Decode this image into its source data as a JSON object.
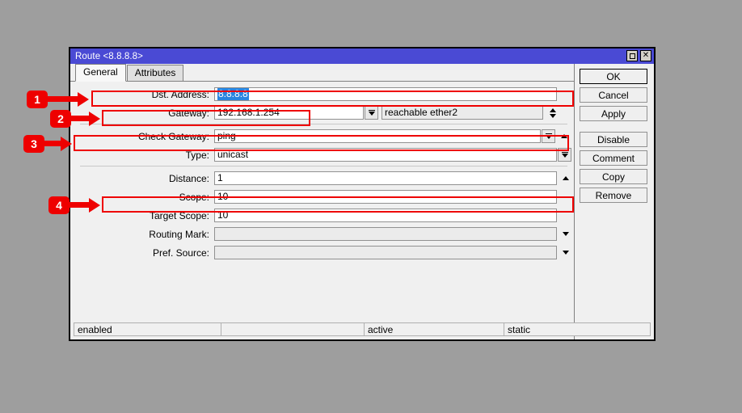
{
  "window": {
    "title": "Route <8.8.8.8>",
    "controls": {
      "maximize": "maximize-icon",
      "close": "✕"
    }
  },
  "tabs": [
    {
      "label": "General",
      "active": true
    },
    {
      "label": "Attributes",
      "active": false
    }
  ],
  "form": {
    "fields": [
      {
        "label": "Dst. Address:",
        "value": "8.8.8.8",
        "selected": true
      },
      {
        "label": "Gateway:",
        "value": "192.168.1.254",
        "secondary": "reachable ether2"
      },
      {
        "label": "Check Gateway:",
        "value": "ping"
      },
      {
        "label": "Type:",
        "value": "unicast"
      },
      {
        "label": "Distance:",
        "value": "1"
      },
      {
        "label": "Scope:",
        "value": "10"
      },
      {
        "label": "Target Scope:",
        "value": "10"
      },
      {
        "label": "Routing Mark:",
        "value": ""
      },
      {
        "label": "Pref. Source:",
        "value": ""
      }
    ]
  },
  "buttons": [
    {
      "label": "OK",
      "focused": true
    },
    {
      "label": "Cancel"
    },
    {
      "label": "Apply"
    },
    {
      "label": "Disable"
    },
    {
      "label": "Comment"
    },
    {
      "label": "Copy"
    },
    {
      "label": "Remove"
    }
  ],
  "status": [
    {
      "text": "enabled"
    },
    {
      "text": ""
    },
    {
      "text": "active"
    },
    {
      "text": "static"
    }
  ],
  "annotations": [
    {
      "number": "1",
      "target": "Dst. Address:"
    },
    {
      "number": "2",
      "target": "Gateway:"
    },
    {
      "number": "3",
      "target": "Check Gateway:"
    },
    {
      "number": "4",
      "target": "Scope:"
    }
  ],
  "colors": {
    "titlebar": "#4a4ad4",
    "desktop": "#9e9e9e",
    "annotation": "#ee0000",
    "selection": "#2a85e0"
  }
}
